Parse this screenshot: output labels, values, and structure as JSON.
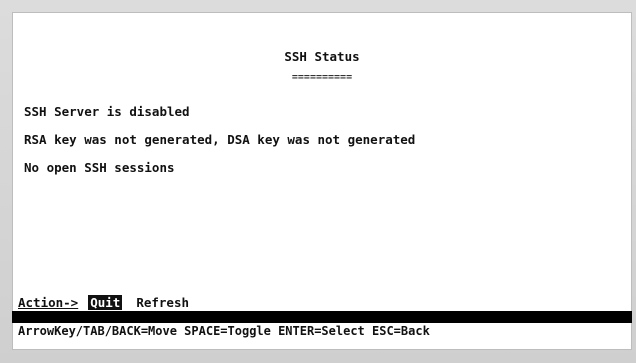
{
  "screen": {
    "title": "SSH Status",
    "title_underline": "==========",
    "lines": [
      "SSH Server is disabled",
      "RSA key was not generated, DSA key was not generated",
      "No open SSH sessions"
    ]
  },
  "action_bar": {
    "label": "Action->",
    "quit_label": "Quit",
    "refresh_label": "Refresh"
  },
  "help_bar": {
    "text": "ArrowKey/TAB/BACK=Move  SPACE=Toggle  ENTER=Select  ESC=Back"
  },
  "colors": {
    "background": "#ffffff",
    "text": "#111111",
    "highlight_bg": "#111111",
    "highlight_text": "#ffffff",
    "divider": "#000000"
  }
}
